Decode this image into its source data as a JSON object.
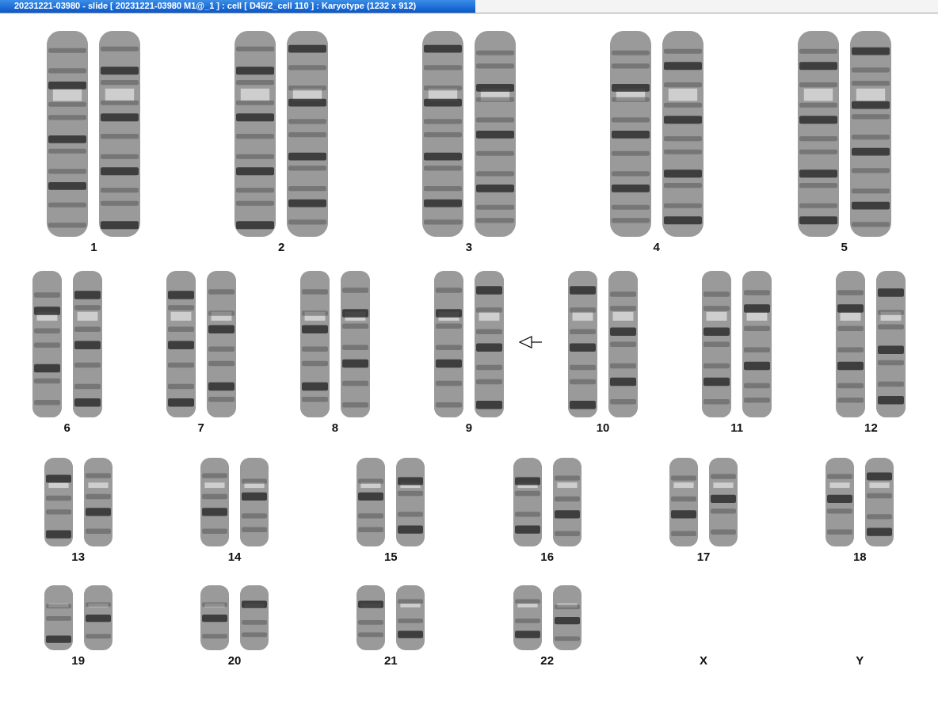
{
  "window": {
    "title": "20231221-03980 - slide [ 20231221-03980 M1@_1 ] : cell [ D45/2_cell 110 ] : Karyotype  (1232 x 912)"
  },
  "karyotype": {
    "rows": [
      {
        "pairs": [
          {
            "label": "1",
            "kind": "pair",
            "marked": false
          },
          {
            "label": "2",
            "kind": "pair",
            "marked": false
          },
          {
            "label": "3",
            "kind": "pair",
            "marked": false
          },
          {
            "label": "4",
            "kind": "pair",
            "marked": false
          },
          {
            "label": "5",
            "kind": "pair",
            "marked": false
          }
        ]
      },
      {
        "pairs": [
          {
            "label": "6",
            "kind": "pair",
            "marked": false
          },
          {
            "label": "7",
            "kind": "pair",
            "marked": false
          },
          {
            "label": "8",
            "kind": "pair",
            "marked": false
          },
          {
            "label": "9",
            "kind": "pair",
            "marked": true
          },
          {
            "label": "10",
            "kind": "pair",
            "marked": false
          },
          {
            "label": "11",
            "kind": "pair",
            "marked": false
          },
          {
            "label": "12",
            "kind": "pair",
            "marked": false
          }
        ]
      },
      {
        "pairs": [
          {
            "label": "13",
            "kind": "pair",
            "marked": false
          },
          {
            "label": "14",
            "kind": "pair",
            "marked": false
          },
          {
            "label": "15",
            "kind": "pair",
            "marked": false
          },
          {
            "label": "16",
            "kind": "pair",
            "marked": false
          },
          {
            "label": "17",
            "kind": "pair",
            "marked": false
          },
          {
            "label": "18",
            "kind": "pair",
            "marked": false
          }
        ]
      },
      {
        "pairs": [
          {
            "label": "19",
            "kind": "pair",
            "marked": false
          },
          {
            "label": "20",
            "kind": "pair",
            "marked": false
          },
          {
            "label": "21",
            "kind": "pair",
            "marked": false
          },
          {
            "label": "22",
            "kind": "pair",
            "marked": false
          },
          {
            "label": "X",
            "kind": "empty",
            "marked": false
          },
          {
            "label": "Y",
            "kind": "empty",
            "marked": false
          }
        ]
      }
    ]
  }
}
